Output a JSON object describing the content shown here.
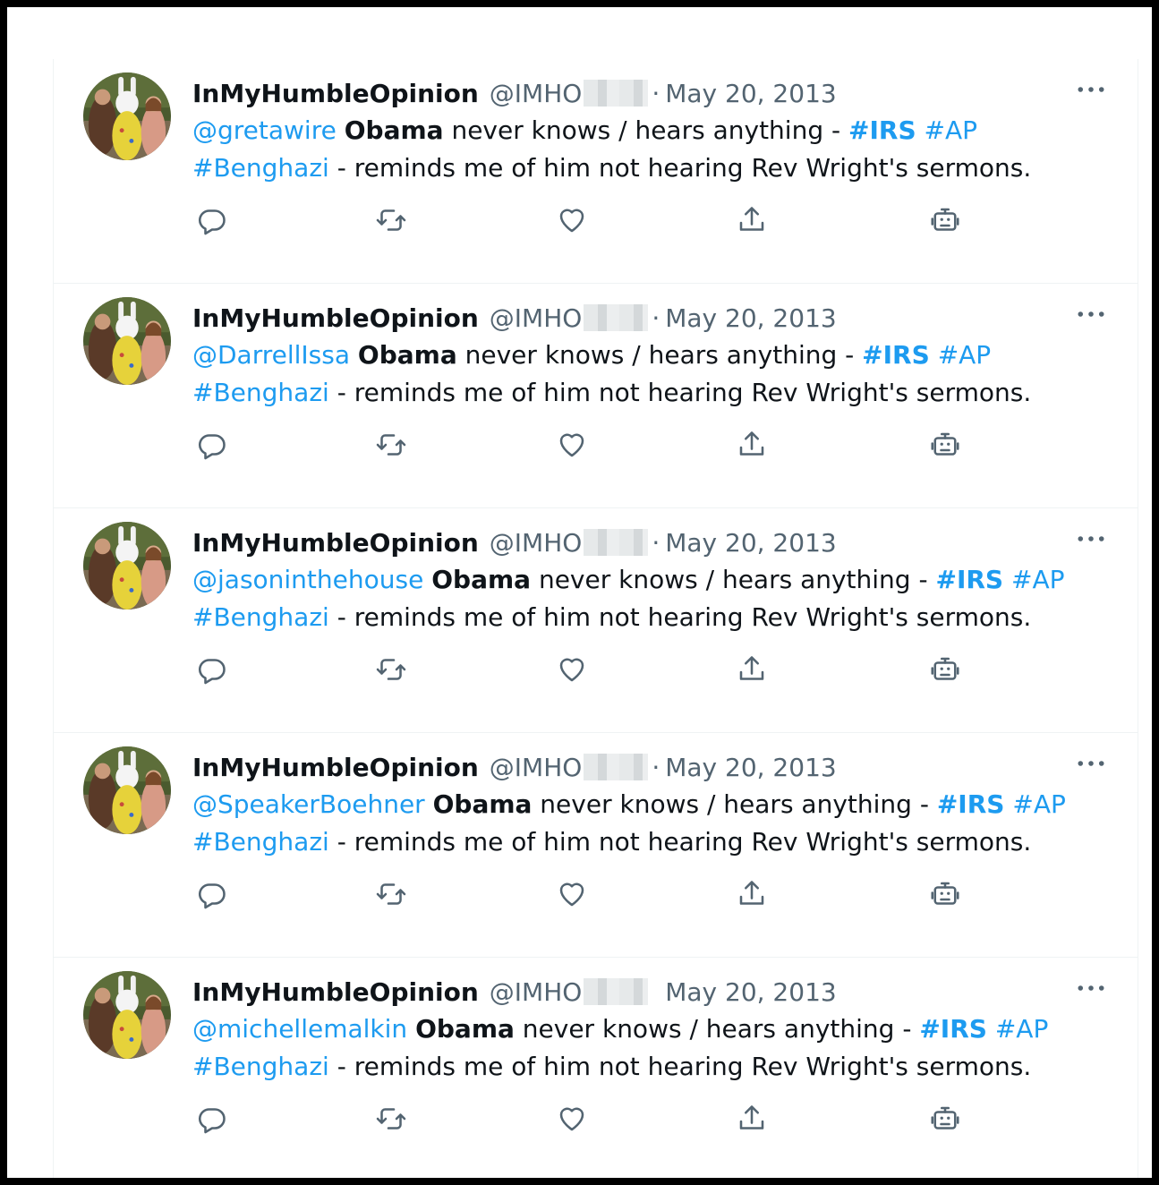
{
  "tweets": [
    {
      "display_name": "InMyHumbleOpinion",
      "handle": "@IMHO",
      "date": "May 20, 2013",
      "mention": "@gretawire",
      "subject": "Obama",
      "body1": " never knows / hears anything - ",
      "tag_irs": "#IRS",
      "tag_ap": "#AP",
      "tag_benghazi": "#Benghazi",
      "body2": " - reminds me of him not hearing Rev Wright's sermons."
    },
    {
      "display_name": "InMyHumbleOpinion",
      "handle": "@IMHO",
      "date": "May 20, 2013",
      "mention": "@DarrellIssa",
      "subject": "Obama",
      "body1": " never knows / hears anything - ",
      "tag_irs": "#IRS",
      "tag_ap": "#AP",
      "tag_benghazi": "#Benghazi",
      "body2": " - reminds me of him not hearing Rev Wright's sermons."
    },
    {
      "display_name": "InMyHumbleOpinion",
      "handle": "@IMHO",
      "date": "May 20, 2013",
      "mention": "@jasoninthehouse",
      "subject": "Obama",
      "body1": " never knows / hears anything - ",
      "tag_irs": "#IRS",
      "tag_ap": "#AP",
      "tag_benghazi": "#Benghazi",
      "body2": " - reminds me of him not hearing Rev Wright's sermons."
    },
    {
      "display_name": "InMyHumbleOpinion",
      "handle": "@IMHO",
      "date": "May 20, 2013",
      "mention": "@SpeakerBoehner",
      "subject": "Obama",
      "body1": " never knows / hears anything - ",
      "tag_irs": "#IRS",
      "tag_ap": "#AP",
      "tag_benghazi": "#Benghazi",
      "body2": " - reminds me of him not hearing Rev Wright's sermons."
    },
    {
      "display_name": "InMyHumbleOpinion",
      "handle": "@IMHO",
      "date": "May 20, 2013",
      "mention": "@michellemalkin",
      "subject": "Obama",
      "body1": " never knows / hears anything - ",
      "tag_irs": "#IRS",
      "tag_ap": "#AP",
      "tag_benghazi": "#Benghazi",
      "body2": " - reminds me of him not hearing Rev Wright's sermons."
    }
  ],
  "header_separator": "·",
  "icons": {
    "more": "more-icon",
    "reply": "reply-icon",
    "retweet": "retweet-icon",
    "like": "like-icon",
    "share": "share-icon",
    "bot": "bot-icon"
  },
  "colors": {
    "link": "#1d9bf0",
    "text": "#0f1419",
    "secondary": "#536471",
    "border": "#eff3f4"
  }
}
